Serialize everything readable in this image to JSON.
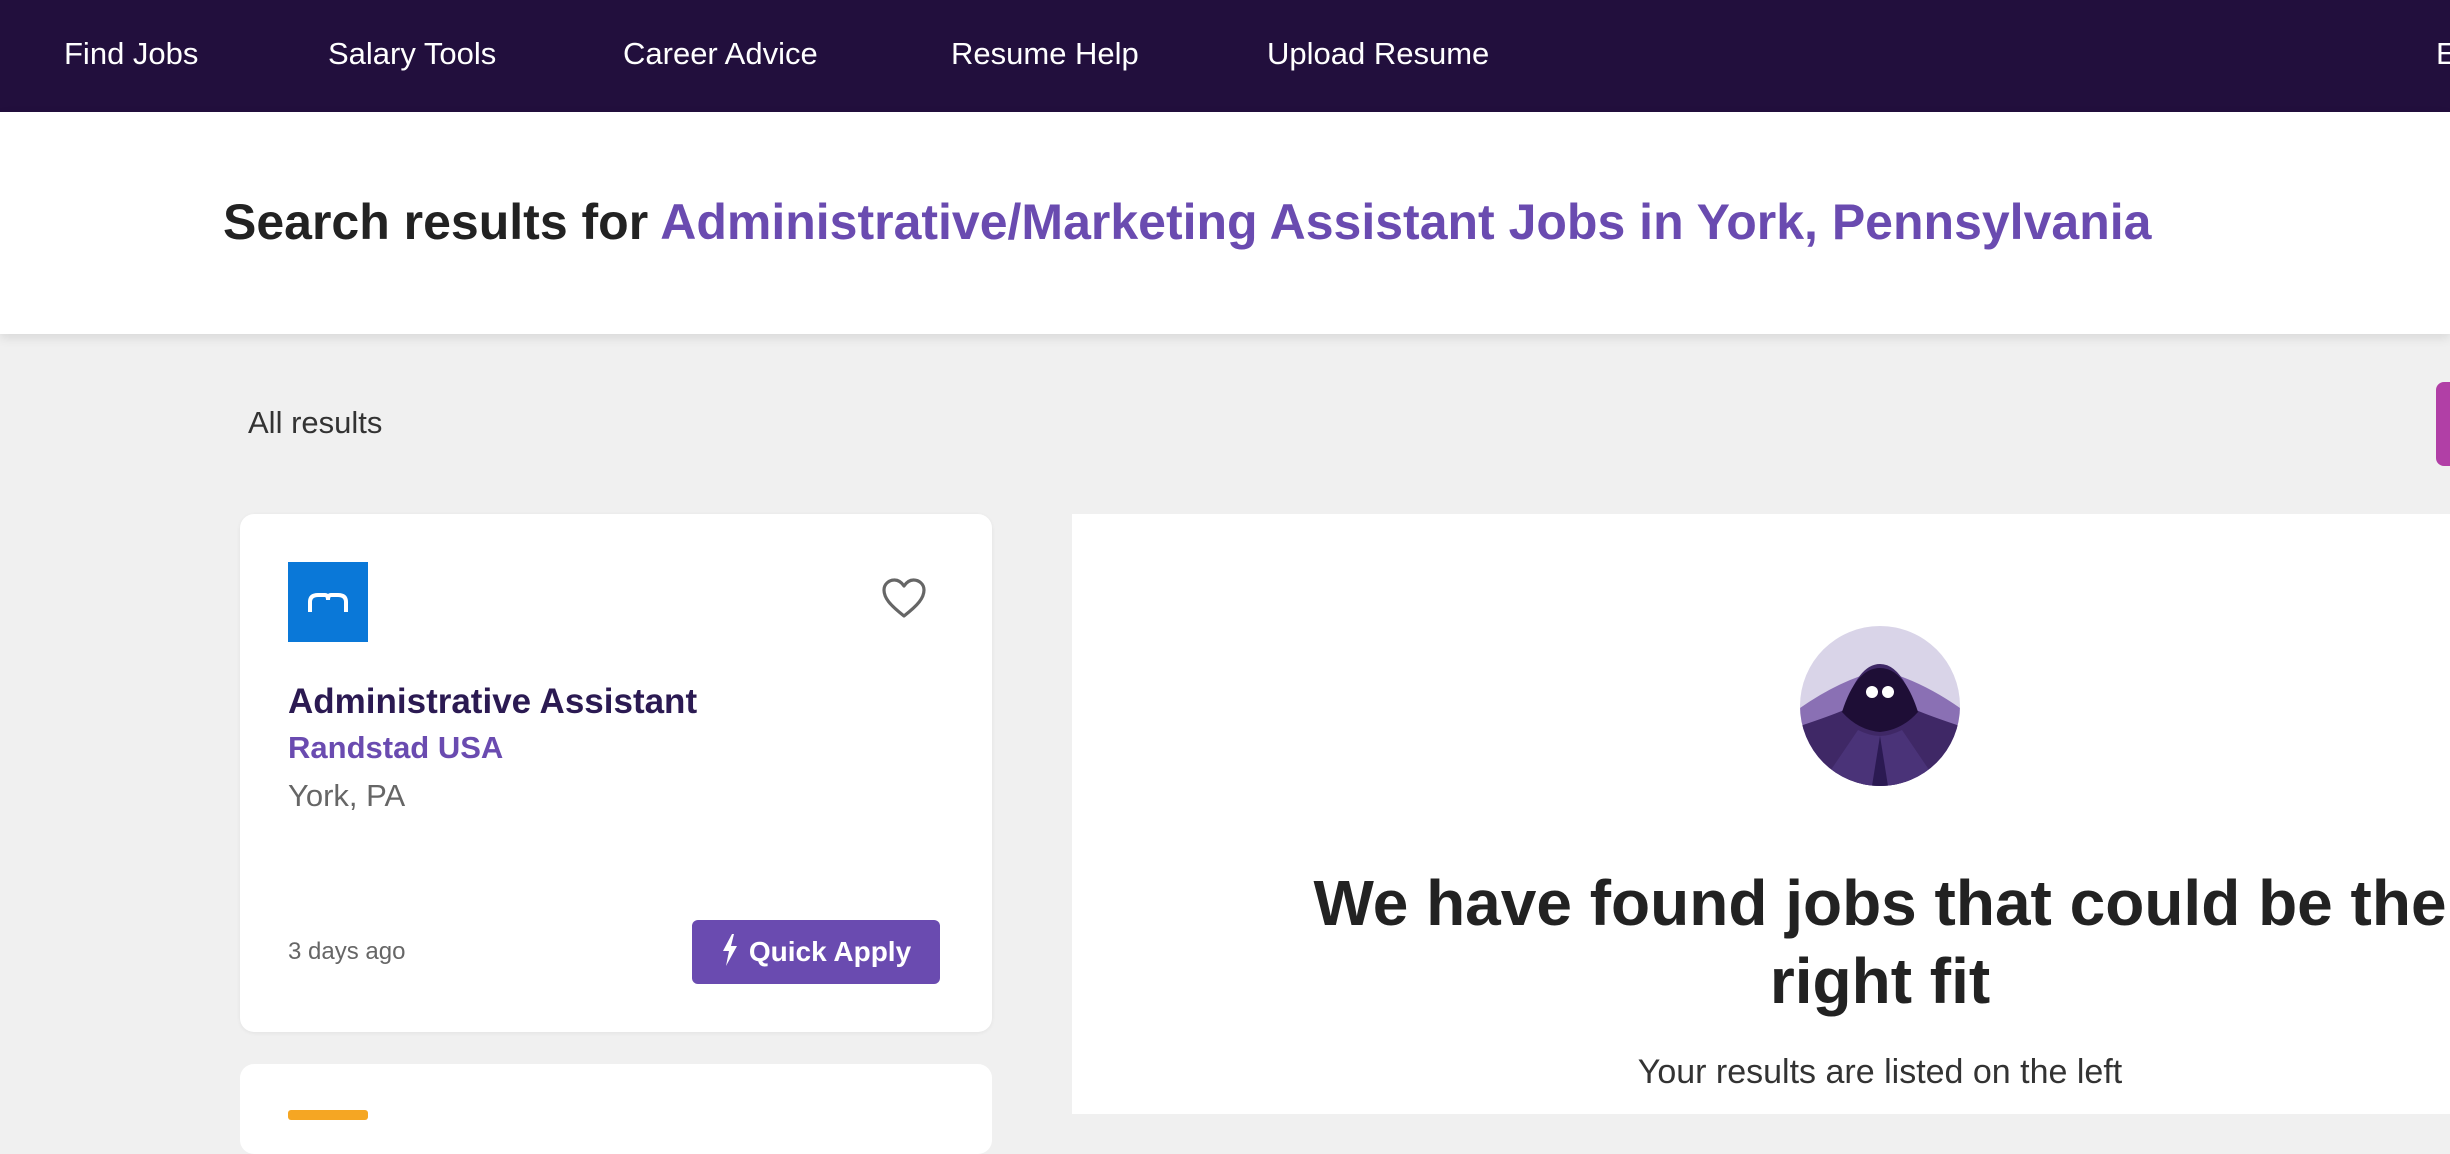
{
  "nav": {
    "items": [
      "Find Jobs",
      "Salary Tools",
      "Career Advice",
      "Resume Help",
      "Upload Resume"
    ],
    "partial_item": "E"
  },
  "search": {
    "prefix": "Search results for",
    "query": "Administrative/Marketing Assistant Jobs in York, Pennsylvania"
  },
  "results": {
    "label": "All results"
  },
  "jobs": [
    {
      "title": "Administrative Assistant",
      "company": "Randstad USA",
      "location": "York, PA",
      "posted": "3 days ago",
      "apply_label": "Quick Apply",
      "logo_color": "#0a78d8"
    }
  ],
  "detail": {
    "heading": "We have found jobs that could be the right fit",
    "subtext": "Your results are listed on the left"
  },
  "colors": {
    "nav_bg": "#220f3d",
    "accent": "#6a4bb0",
    "side_tab": "#b13fa6",
    "next_logo": "#f5a623"
  },
  "icons": {
    "save": "heart-icon",
    "apply": "lightning-icon",
    "company_logo": "randstad-logo",
    "illustration": "hooded-figure-avatar"
  }
}
